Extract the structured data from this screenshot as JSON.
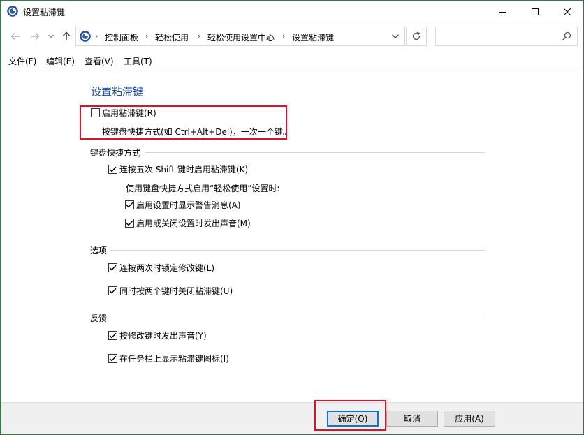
{
  "window": {
    "title": "设置粘滞键",
    "accent": "#2d7d46"
  },
  "nav": {
    "breadcrumbs": [
      "控制面板",
      "轻松使用",
      "轻松使用设置中心",
      "设置粘滞键"
    ],
    "search_placeholder": ""
  },
  "menu": {
    "items": [
      "文件(F)",
      "编辑(E)",
      "查看(V)",
      "工具(T)"
    ]
  },
  "main": {
    "title": "设置粘滞键",
    "title_color": "#1e4b9e",
    "highlight_color": "#e0102c",
    "enable": {
      "label": "启用粘滞键(R)",
      "checked": false
    },
    "enable_desc": "按键盘快捷方式(如 Ctrl+Alt+Del)，一次一个键。"
  },
  "groups": {
    "shortcut": {
      "title": "键盘快捷方式",
      "shift5": {
        "label": "连按五次 Shift 键时启用粘滞键(K)",
        "checked": true
      },
      "note": "使用键盘快捷方式启用“轻松使用”设置时:",
      "warn": {
        "label": "启用设置时显示警告消息(A)",
        "checked": true
      },
      "sound": {
        "label": "启用或关闭设置时发出声音(M)",
        "checked": true
      }
    },
    "options": {
      "title": "选项",
      "lock": {
        "label": "连按两次时锁定修改键(L)",
        "checked": true
      },
      "turnoff": {
        "label": "同时按两个键时关闭粘滞键(U)",
        "checked": true
      }
    },
    "feedback": {
      "title": "反馈",
      "beep": {
        "label": "按修改键时发出声音(Y)",
        "checked": true
      },
      "tray": {
        "label": "在任务栏上显示粘滞键图标(I)",
        "checked": true
      }
    }
  },
  "buttons": {
    "ok": "确定(O)",
    "cancel": "取消",
    "apply": "应用(A)"
  }
}
